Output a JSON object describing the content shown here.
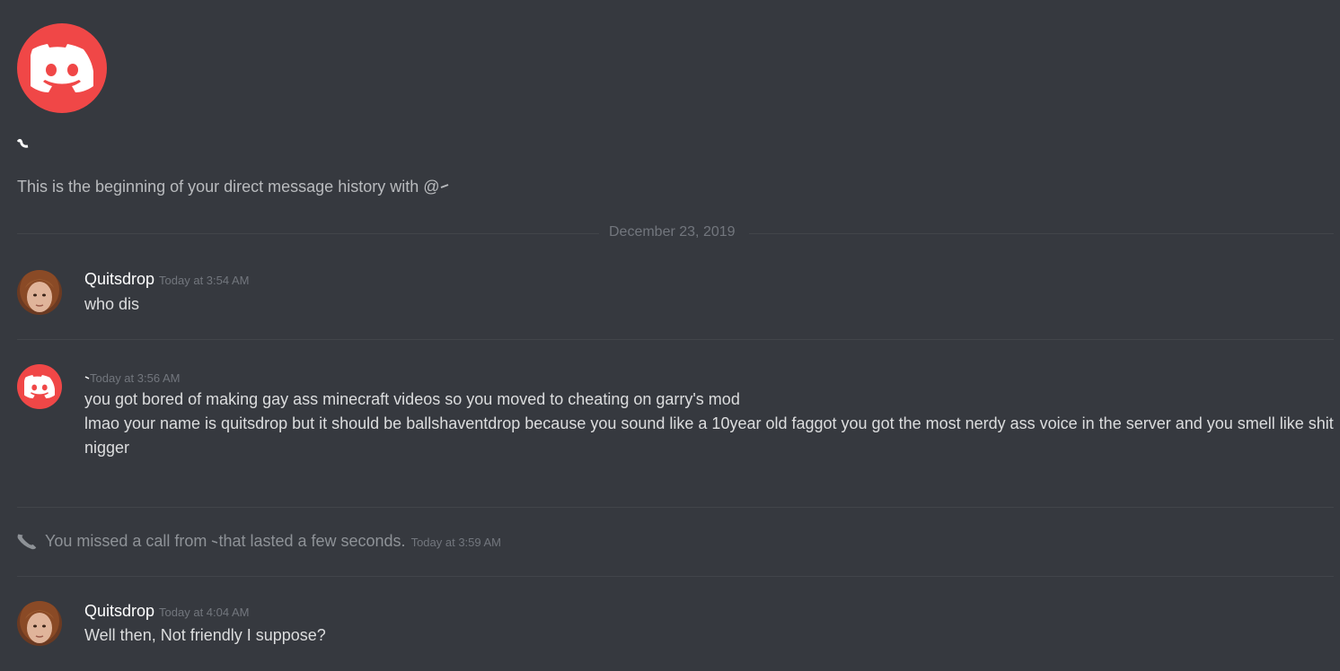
{
  "intro": {
    "text_prefix": "This is the beginning of your direct message history with @"
  },
  "date_divider": "December 23, 2019",
  "messages": [
    {
      "author": "Quitsdrop",
      "timestamp": "Today at 3:54 AM",
      "lines": [
        "who dis"
      ]
    },
    {
      "author": "",
      "timestamp": "Today at 3:56 AM",
      "lines": [
        "you got bored of making gay ass minecraft videos so you moved to cheating on garry's mod",
        "lmao your name is quitsdrop but it should be ballshaventdrop because you sound like a 10year old faggot you got the most nerdy ass voice in the server and you smell like shit",
        "nigger"
      ]
    },
    {
      "author": "Quitsdrop",
      "timestamp": "Today at 4:04 AM",
      "lines": [
        "Well then, Not friendly I suppose?"
      ]
    }
  ],
  "missed_call": {
    "prefix": "You missed a call from",
    "suffix": "that lasted a few seconds.",
    "timestamp": "Today at 3:59 AM"
  },
  "colors": {
    "background": "#36393f",
    "discord_red": "#f04747",
    "author_text": "#ffffff",
    "message_text": "#dcddde",
    "muted_text": "#72767d"
  },
  "icons": {
    "default_avatar": "discord-logo-icon",
    "missed_call": "phone-missed-icon",
    "user_avatar": "user-photo-avatar"
  }
}
